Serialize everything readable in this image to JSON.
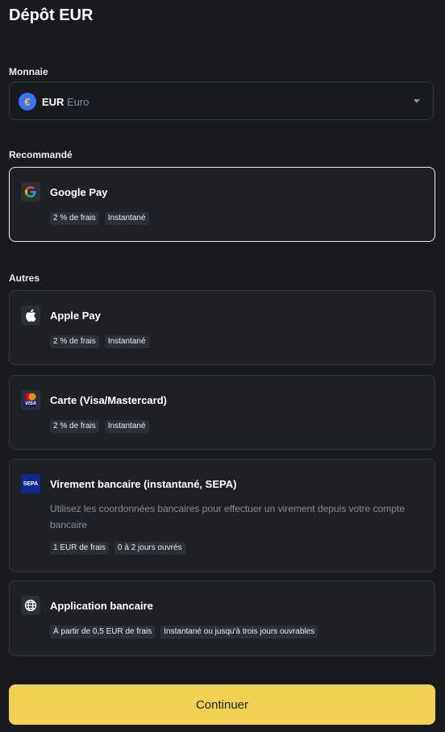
{
  "page": {
    "title": "Dépôt EUR"
  },
  "currency": {
    "label": "Monnaie",
    "icon_glyph": "€",
    "code": "EUR",
    "name": "Euro"
  },
  "recommended": {
    "label": "Recommandé",
    "items": [
      {
        "title": "Google Pay",
        "icon": "google-icon",
        "tags": [
          "2 % de frais",
          "Instantané"
        ]
      }
    ]
  },
  "others": {
    "label": "Autres",
    "items": [
      {
        "title": "Apple Pay",
        "icon": "apple-icon",
        "tags": [
          "2 % de frais",
          "Instantané"
        ]
      },
      {
        "title": "Carte (Visa/Mastercard)",
        "icon": "card-icon",
        "icon_text": "VISA",
        "tags": [
          "2 % de frais",
          "Instantané"
        ]
      },
      {
        "title": "Virement bancaire (instantané, SEPA)",
        "icon": "sepa-icon",
        "icon_text": "SEPA",
        "description": "Utilisez les coordonnées bancaires pour effectuer un virement depuis votre compte bancaire",
        "tags": [
          "1 EUR de frais",
          "0 à 2 jours ouvrés"
        ]
      },
      {
        "title": "Application bancaire",
        "icon": "bank-app-icon",
        "tags": [
          "À partir de 0,5 EUR de frais",
          "Instantané ou jusqu'à trois jours ouvrables"
        ]
      }
    ]
  },
  "actions": {
    "continue_label": "Continuer"
  },
  "colors": {
    "accent": "#f0d153",
    "background": "#181a20",
    "card": "#1e2026"
  }
}
